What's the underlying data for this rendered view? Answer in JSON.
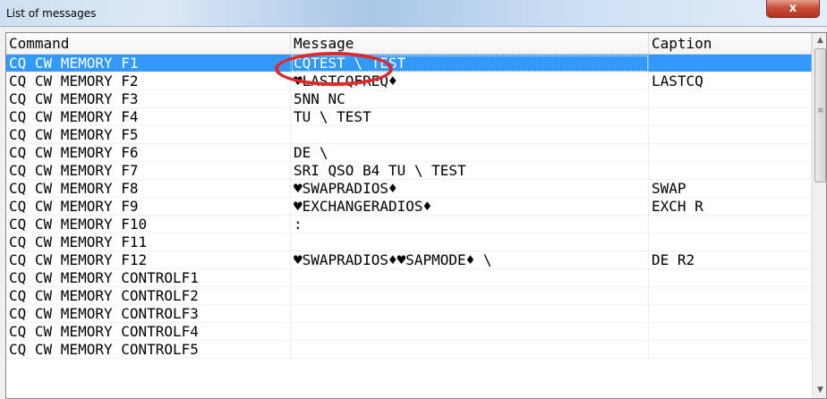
{
  "window": {
    "title": "List of messages",
    "close_label": "x"
  },
  "columns": {
    "command": "Command",
    "message": "Message",
    "caption": "Caption"
  },
  "rows": [
    {
      "command": "CQ CW MEMORY F1",
      "message": "CQTEST \\ TEST",
      "caption": ""
    },
    {
      "command": "CQ CW MEMORY F2",
      "message": "♥LASTCQFREQ♦",
      "caption": "LASTCQ"
    },
    {
      "command": "CQ CW MEMORY F3",
      "message": "5NN NC",
      "caption": ""
    },
    {
      "command": "CQ CW MEMORY F4",
      "message": "TU \\ TEST",
      "caption": ""
    },
    {
      "command": "CQ CW MEMORY F5",
      "message": "",
      "caption": ""
    },
    {
      "command": "CQ CW MEMORY F6",
      "message": "DE \\",
      "caption": ""
    },
    {
      "command": "CQ CW MEMORY F7",
      "message": "SRI QSO B4 TU \\ TEST",
      "caption": ""
    },
    {
      "command": "CQ CW MEMORY F8",
      "message": "♥SWAPRADIOS♦",
      "caption": "SWAP"
    },
    {
      "command": "CQ CW MEMORY F9",
      "message": "♥EXCHANGERADIOS♦",
      "caption": "EXCH R"
    },
    {
      "command": "CQ CW MEMORY F10",
      "message": ":",
      "caption": ""
    },
    {
      "command": "CQ CW MEMORY F11",
      "message": "",
      "caption": ""
    },
    {
      "command": "CQ CW MEMORY F12",
      "message": "♥SWAPRADIOS♦♥SAPMODE♦ \\",
      "caption": "DE R2"
    },
    {
      "command": "CQ CW MEMORY CONTROLF1",
      "message": "",
      "caption": ""
    },
    {
      "command": "CQ CW MEMORY CONTROLF2",
      "message": "",
      "caption": ""
    },
    {
      "command": "CQ CW MEMORY CONTROLF3",
      "message": "",
      "caption": ""
    },
    {
      "command": "CQ CW MEMORY CONTROLF4",
      "message": "",
      "caption": ""
    },
    {
      "command": "CQ CW MEMORY CONTROLF5",
      "message": "",
      "caption": ""
    }
  ],
  "selected_row": 0,
  "colors": {
    "selection": "#3399ff",
    "annotation": "#e0282a",
    "close_button": "#c7503a"
  }
}
